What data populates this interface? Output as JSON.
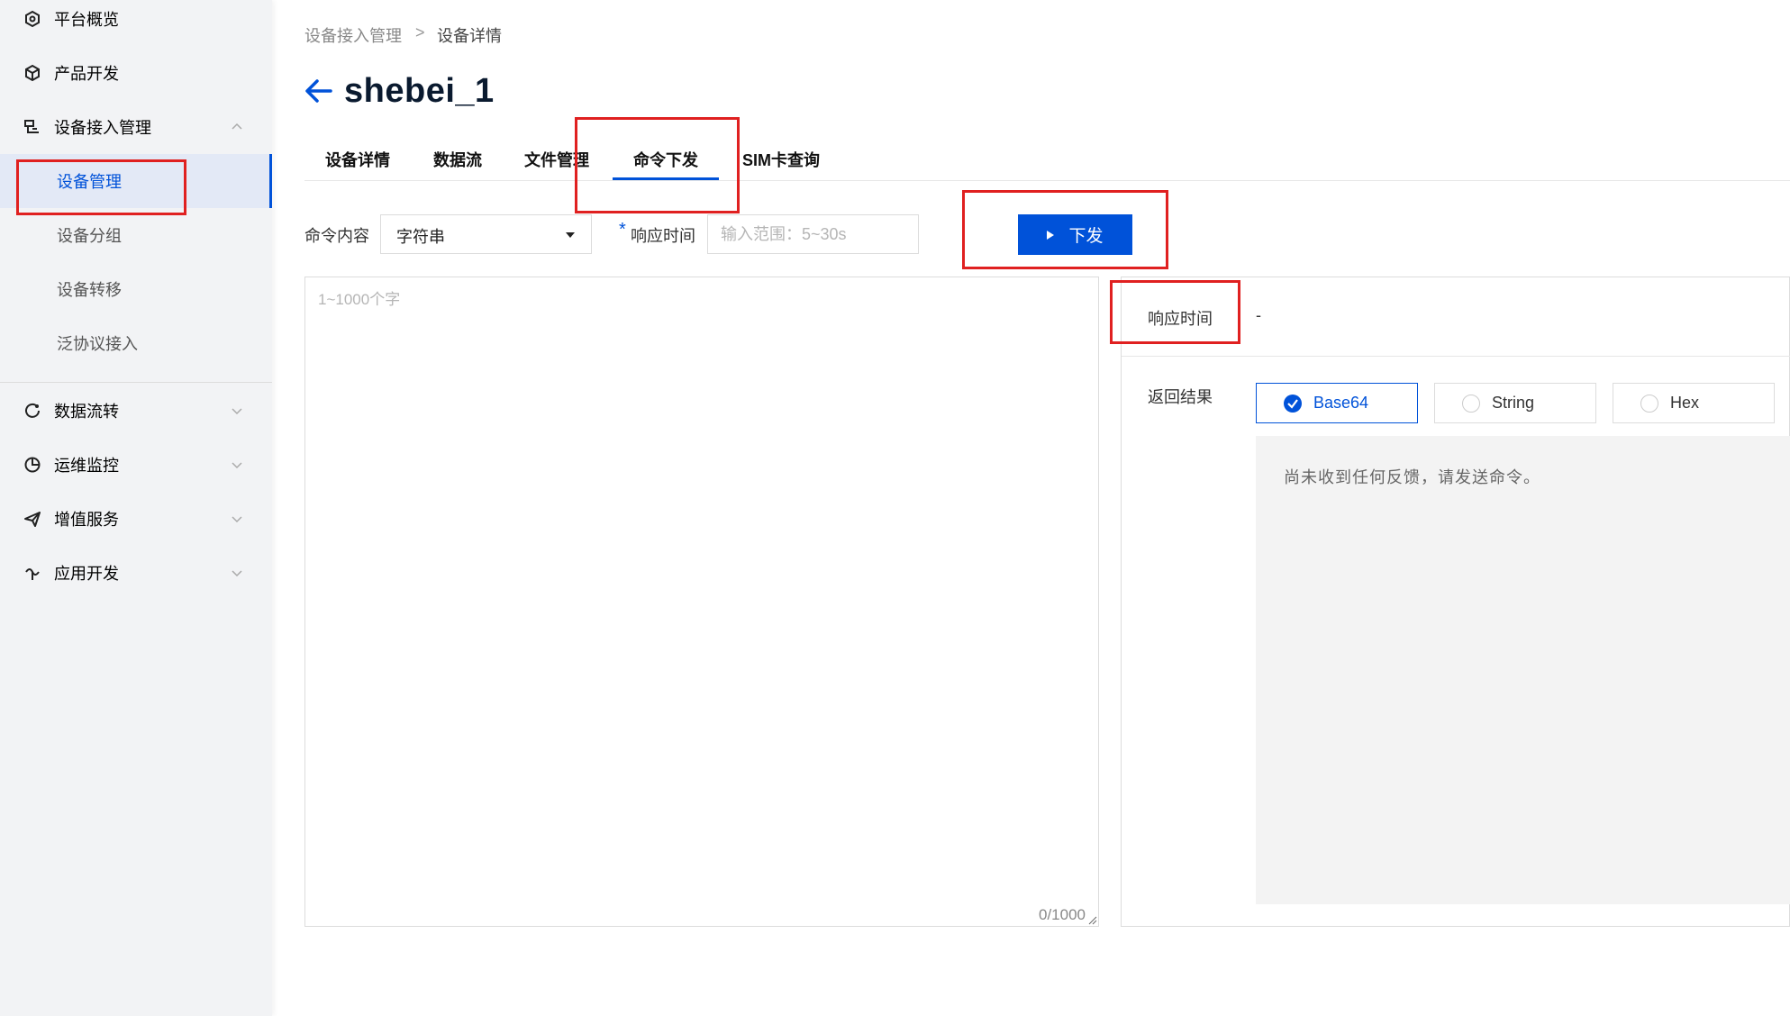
{
  "colors": {
    "primary": "#0052d9",
    "annotation": "#e02020",
    "sidebar_bg": "#f2f3f5"
  },
  "sidebar": {
    "items": [
      {
        "label": "平台概览",
        "icon": "overview-icon"
      },
      {
        "label": "产品开发",
        "icon": "cube-icon"
      },
      {
        "label": "设备接入管理",
        "icon": "device-access-icon",
        "expanded": true,
        "children": [
          {
            "label": "设备管理",
            "active": true
          },
          {
            "label": "设备分组"
          },
          {
            "label": "设备转移"
          },
          {
            "label": "泛协议接入"
          }
        ]
      },
      {
        "label": "数据流转",
        "icon": "data-flow-icon",
        "expanded": false
      },
      {
        "label": "运维监控",
        "icon": "pie-chart-icon",
        "expanded": false
      },
      {
        "label": "增值服务",
        "icon": "paper-plane-icon",
        "expanded": false
      },
      {
        "label": "应用开发",
        "icon": "dev-icon",
        "expanded": false
      }
    ]
  },
  "breadcrumb": {
    "items": [
      "设备接入管理",
      "设备详情"
    ],
    "separator": ">"
  },
  "page_title": "shebei_1",
  "tabs": [
    {
      "label": "设备详情"
    },
    {
      "label": "数据流"
    },
    {
      "label": "文件管理"
    },
    {
      "label": "命令下发",
      "active": true
    },
    {
      "label": "SIM卡查询"
    }
  ],
  "form": {
    "cmd_label": "命令内容",
    "cmd_type_value": "字符串",
    "timeout_label": "响应时间",
    "required_mark": "*",
    "timeout_placeholder": "输入范围：5~30s",
    "send_label": "下发",
    "textarea_placeholder": "1~1000个字",
    "char_count": "0/1000"
  },
  "result": {
    "response_time_label": "响应时间",
    "response_time_value": "-",
    "return_label": "返回结果",
    "formats": [
      {
        "label": "Base64",
        "selected": true
      },
      {
        "label": "String",
        "selected": false
      },
      {
        "label": "Hex",
        "selected": false
      }
    ],
    "empty_text": "尚未收到任何反馈，请发送命令。"
  }
}
